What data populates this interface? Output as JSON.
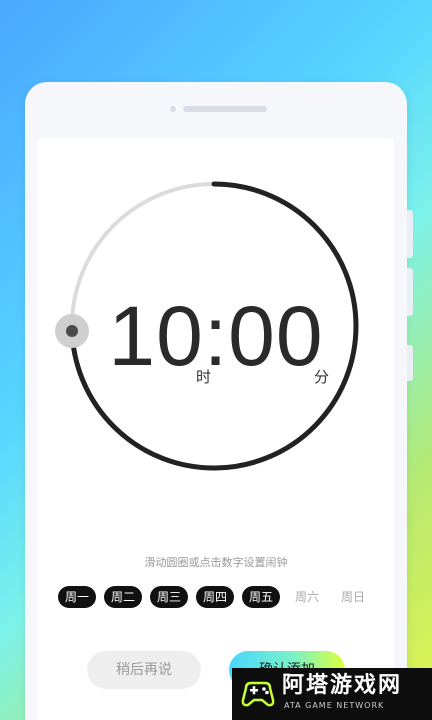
{
  "clock": {
    "time": "10:00",
    "hour_unit": "时",
    "minute_unit": "分"
  },
  "hint": "滑动圆圈或点击数字设置闹钟",
  "weekdays": [
    {
      "label": "周一",
      "selected": true
    },
    {
      "label": "周二",
      "selected": true
    },
    {
      "label": "周三",
      "selected": true
    },
    {
      "label": "周四",
      "selected": true
    },
    {
      "label": "周五",
      "selected": true
    },
    {
      "label": "周六",
      "selected": false
    },
    {
      "label": "周日",
      "selected": false
    }
  ],
  "buttons": {
    "later": "稍后再说",
    "confirm": "确认添加"
  },
  "watermark": {
    "name": "阿塔游戏网",
    "subtitle": "ATA GAME NETWORK"
  },
  "colors": {
    "dial_active": "#222222",
    "dial_track": "#dddddd",
    "day_selected_bg": "#111111"
  }
}
